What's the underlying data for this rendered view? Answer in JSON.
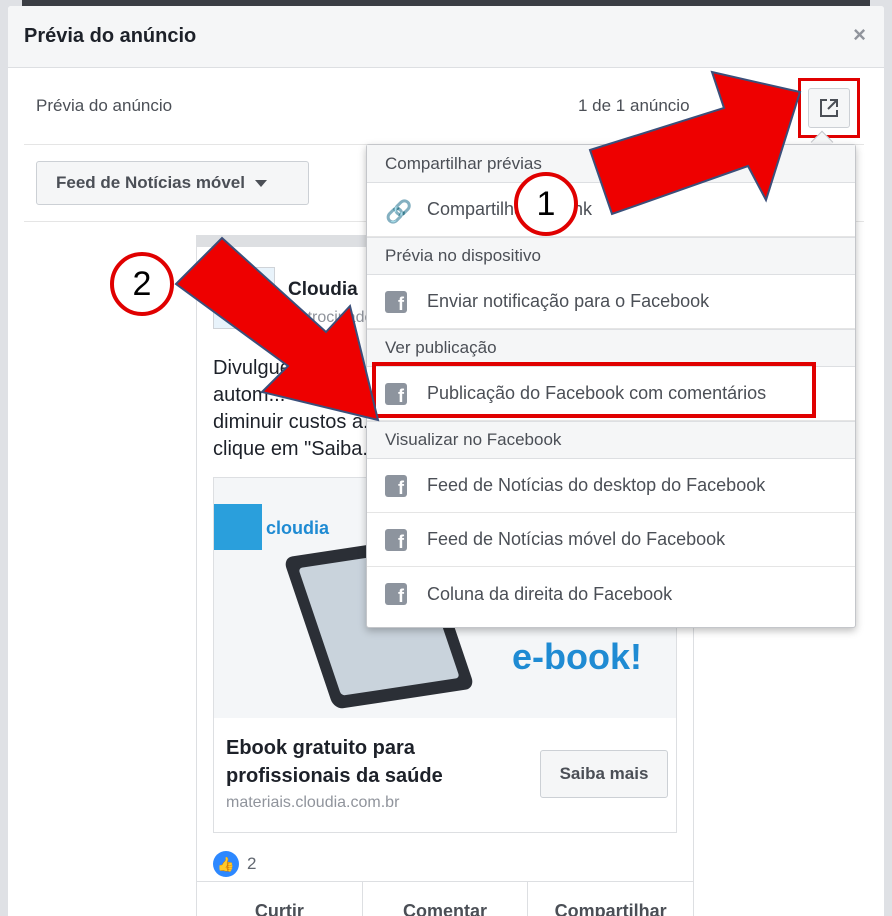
{
  "modal": {
    "title": "Prévia do anúncio",
    "close_label": "×",
    "subheader": "Prévia do anúncio",
    "count": "1 de 1 anúncio",
    "placement_label": "Feed de Notícias móvel"
  },
  "ad": {
    "page_name": "Cloudia",
    "sponsored": "Patrocinado",
    "text_lines": [
      "Divulgue prof...",
      "autom...",
      "diminuir custos a...",
      "clique em \"Saiba..."
    ],
    "brand": "cloudia",
    "image_word": "e-book!",
    "link_title": "Ebook gratuito para profissionais da saúde",
    "link_url": "materiais.cloudia.com.br",
    "cta": "Saiba mais",
    "like_count": "2",
    "actions": [
      "Curtir",
      "Comentar",
      "Compartilhar"
    ]
  },
  "menu": {
    "sections": [
      {
        "title": "Compartilhar prévias",
        "items": [
          {
            "label": "Compartilhar um link",
            "icon": "link-icon"
          }
        ]
      },
      {
        "title": "Prévia no dispositivo",
        "items": [
          {
            "label": "Enviar notificação para o Facebook",
            "icon": "facebook-icon"
          }
        ]
      },
      {
        "title": "Ver publicação",
        "items": [
          {
            "label": "Publicação do Facebook com comentários",
            "icon": "facebook-icon"
          }
        ]
      },
      {
        "title": "Visualizar no Facebook",
        "items": [
          {
            "label": "Feed de Notícias do desktop do Facebook",
            "icon": "facebook-icon"
          },
          {
            "label": "Feed de Notícias móvel do Facebook",
            "icon": "facebook-icon"
          },
          {
            "label": "Coluna da direita do Facebook",
            "icon": "facebook-icon"
          }
        ]
      }
    ]
  },
  "annotations": {
    "step1": "1",
    "step2": "2",
    "color": "#e00000"
  }
}
